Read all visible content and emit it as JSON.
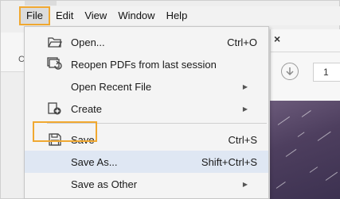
{
  "menubar": {
    "items": [
      {
        "label": "File"
      },
      {
        "label": "Edit"
      },
      {
        "label": "View"
      },
      {
        "label": "Window"
      },
      {
        "label": "Help"
      }
    ]
  },
  "file_menu": {
    "items": [
      {
        "label": "Open...",
        "shortcut": "Ctrl+O",
        "icon": "open-folder-icon"
      },
      {
        "label": "Reopen PDFs from last session",
        "shortcut": "",
        "icon": "reopen-pdfs-icon"
      },
      {
        "label": "Open Recent File",
        "shortcut": "",
        "submenu": true
      },
      {
        "label": "Create",
        "shortcut": "",
        "icon": "create-document-icon",
        "submenu": true
      },
      {
        "label": "Save",
        "shortcut": "Ctrl+S",
        "icon": "floppy-disk-icon"
      },
      {
        "label": "Save As...",
        "shortcut": "Shift+Ctrl+S",
        "highlighted": true
      },
      {
        "label": "Save as Other",
        "shortcut": "",
        "submenu": true
      }
    ]
  },
  "background": {
    "left_stub_label": "C",
    "page_number": "1"
  },
  "colors": {
    "highlight_border": "#f0a830",
    "hover_background": "#dfe7f3",
    "menu_background": "#f4f4f4",
    "document_background": "#4e3f5f"
  }
}
